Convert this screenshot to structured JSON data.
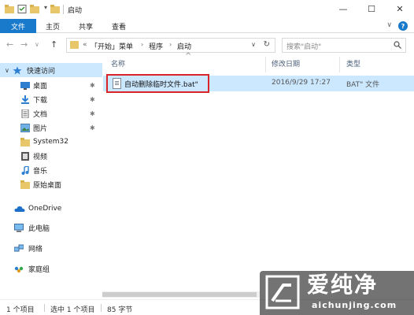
{
  "window": {
    "title": "启动",
    "controls": [
      "—",
      "☐",
      "✕"
    ]
  },
  "ribbon": {
    "file_tab": "文件",
    "tabs": [
      "主页",
      "共享",
      "查看"
    ],
    "expand": "∨",
    "help": "?"
  },
  "address": {
    "prefix": "«",
    "crumbs": [
      "「开始」菜单",
      "程序",
      "启动"
    ],
    "search_placeholder": "搜索\"启动\""
  },
  "nav": {
    "quick_access": "快速访问",
    "items": [
      {
        "label": "桌面",
        "icon": "desktop-icon",
        "pinned": true
      },
      {
        "label": "下载",
        "icon": "download-icon",
        "pinned": true
      },
      {
        "label": "文档",
        "icon": "document-icon",
        "pinned": true
      },
      {
        "label": "图片",
        "icon": "pictures-icon",
        "pinned": true
      },
      {
        "label": "System32",
        "icon": "folder-icon",
        "pinned": false
      },
      {
        "label": "视频",
        "icon": "video-icon",
        "pinned": false
      },
      {
        "label": "音乐",
        "icon": "music-icon",
        "pinned": false
      },
      {
        "label": "原始桌面",
        "icon": "folder-icon",
        "pinned": false
      }
    ],
    "onedrive": "OneDrive",
    "this_pc": "此电脑",
    "network": "网络",
    "homegroup": "家庭组"
  },
  "columns": {
    "name": "名称",
    "modified": "修改日期",
    "type": "类型"
  },
  "files": [
    {
      "name": "自动删除临时文件.bat\"",
      "modified": "2016/9/29 17:27",
      "type": "BAT\" 文件"
    }
  ],
  "status": {
    "count": "1 个项目",
    "selected": "选中 1 个项目",
    "size": "85 字节"
  },
  "watermark": {
    "title": "爱纯净",
    "url": "aichunjing.com"
  },
  "colors": {
    "accent": "#1979ca",
    "selection": "#cce8ff",
    "highlight_box": "#d9242a"
  }
}
